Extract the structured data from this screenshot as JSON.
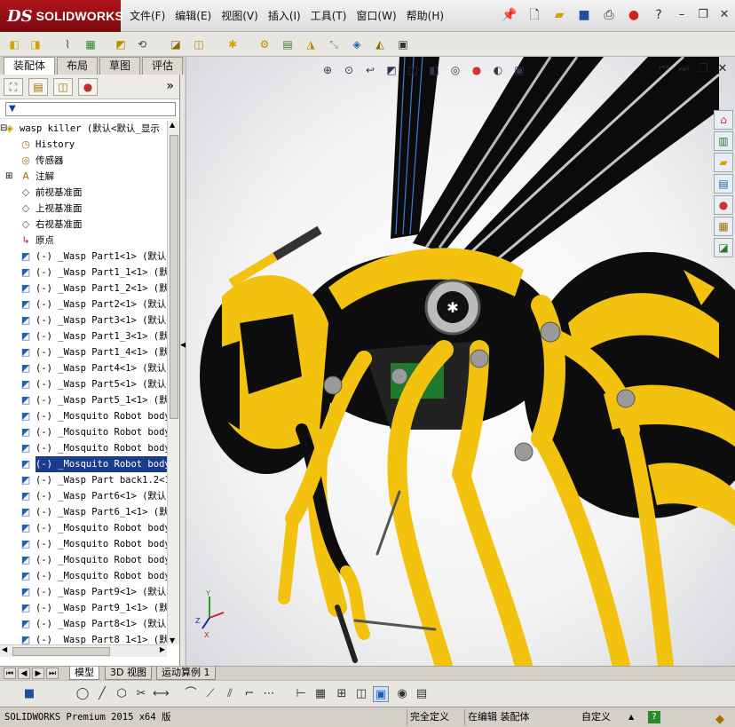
{
  "app": {
    "logo_mark": "DS",
    "logo_text": "SOLIDWORKS"
  },
  "menu": [
    "文件(F)",
    "编辑(E)",
    "视图(V)",
    "插入(I)",
    "工具(T)",
    "窗口(W)",
    "帮助(H)"
  ],
  "title_icons": [
    "pin-icon",
    "new-document-icon",
    "open-icon",
    "save-icon",
    "print-icon",
    "rebuild-traffic-light-icon",
    "help-icon",
    "minimize-icon",
    "restore-icon",
    "close-icon"
  ],
  "command_tabs": [
    {
      "label": "装配体",
      "active": true
    },
    {
      "label": "布局",
      "active": false
    },
    {
      "label": "草图",
      "active": false
    },
    {
      "label": "评估",
      "active": false
    }
  ],
  "panel": {
    "tabs": [
      "feature-manager-icon",
      "property-manager-icon",
      "configuration-manager-icon",
      "display-manager-icon"
    ],
    "expand": "»",
    "filter_symbol": "▼"
  },
  "tree": [
    {
      "label": "wasp killer  (默认<默认_显示",
      "icon": "assembly",
      "indent": 0,
      "expand": "⊟"
    },
    {
      "label": "History",
      "icon": "history",
      "indent": 1
    },
    {
      "label": "传感器",
      "icon": "sensor",
      "indent": 1
    },
    {
      "label": "注解",
      "icon": "annotation",
      "indent": 1,
      "expand": "⊞"
    },
    {
      "label": "前视基准面",
      "icon": "plane",
      "indent": 1
    },
    {
      "label": "上视基准面",
      "icon": "plane",
      "indent": 1
    },
    {
      "label": "右视基准面",
      "icon": "plane",
      "indent": 1
    },
    {
      "label": "原点",
      "icon": "origin",
      "indent": 1
    },
    {
      "label": "(-) _Wasp Part1<1> (默认",
      "icon": "part",
      "indent": 1
    },
    {
      "label": "(-) _Wasp Part1_1<1> (默",
      "icon": "part",
      "indent": 1
    },
    {
      "label": "(-) _Wasp Part1_2<1> (默",
      "icon": "part",
      "indent": 1
    },
    {
      "label": "(-) _Wasp Part2<1> (默认",
      "icon": "part",
      "indent": 1
    },
    {
      "label": "(-) _Wasp Part3<1> (默认",
      "icon": "part",
      "indent": 1
    },
    {
      "label": "(-) _Wasp Part1_3<1> (默",
      "icon": "part",
      "indent": 1
    },
    {
      "label": "(-) _Wasp Part1_4<1> (默",
      "icon": "part",
      "indent": 1
    },
    {
      "label": "(-) _Wasp Part4<1> (默认",
      "icon": "part",
      "indent": 1
    },
    {
      "label": "(-) _Wasp Part5<1> (默认",
      "icon": "part",
      "indent": 1
    },
    {
      "label": "(-) _Wasp Part5_1<1> (默",
      "icon": "part",
      "indent": 1
    },
    {
      "label": "(-) _Mosquito Robot body",
      "icon": "part",
      "indent": 1
    },
    {
      "label": "(-) _Mosquito Robot body",
      "icon": "part",
      "indent": 1
    },
    {
      "label": "(-) _Mosquito Robot body",
      "icon": "part",
      "indent": 1
    },
    {
      "label": "(-) _Mosquito Robot body",
      "icon": "part",
      "indent": 1,
      "selected": true
    },
    {
      "label": "(-) _Wasp Part back1.2<1",
      "icon": "part",
      "indent": 1
    },
    {
      "label": "(-) _Wasp Part6<1> (默认",
      "icon": "part",
      "indent": 1
    },
    {
      "label": "(-) _Wasp Part6_1<1> (默",
      "icon": "part",
      "indent": 1
    },
    {
      "label": "(-) _Mosquito Robot body",
      "icon": "part",
      "indent": 1
    },
    {
      "label": "(-) _Mosquito Robot body",
      "icon": "part",
      "indent": 1
    },
    {
      "label": "(-) _Mosquito Robot body",
      "icon": "part",
      "indent": 1
    },
    {
      "label": "(-) _Mosquito Robot body",
      "icon": "part",
      "indent": 1
    },
    {
      "label": "(-) _Wasp Part9<1> (默认",
      "icon": "part",
      "indent": 1
    },
    {
      "label": "(-) _Wasp Part9_1<1> (默",
      "icon": "part",
      "indent": 1
    },
    {
      "label": "(-) _Wasp Part8<1> (默认",
      "icon": "part",
      "indent": 1
    },
    {
      "label": "(-) _Wasp Part8_1<1> (默",
      "icon": "part",
      "indent": 1
    }
  ],
  "bottom_tabs": [
    {
      "label": "模型",
      "active": true
    },
    {
      "label": "3D 视图",
      "active": false
    },
    {
      "label": "运动算例 1",
      "active": false
    }
  ],
  "triad": {
    "x": "X",
    "y": "Y",
    "z": "Z"
  },
  "status": {
    "app": "SOLIDWORKS Premium 2015 x64 版",
    "definition": "完全定义",
    "editing": "在编辑 装配体",
    "units": "自定义",
    "units_arrow": "▲",
    "help": "?"
  },
  "colors": {
    "logo": "#b0141b",
    "wasp_yellow": "#f2c20f",
    "wasp_black": "#0d0d0d",
    "selection": "#1a3c8c"
  }
}
